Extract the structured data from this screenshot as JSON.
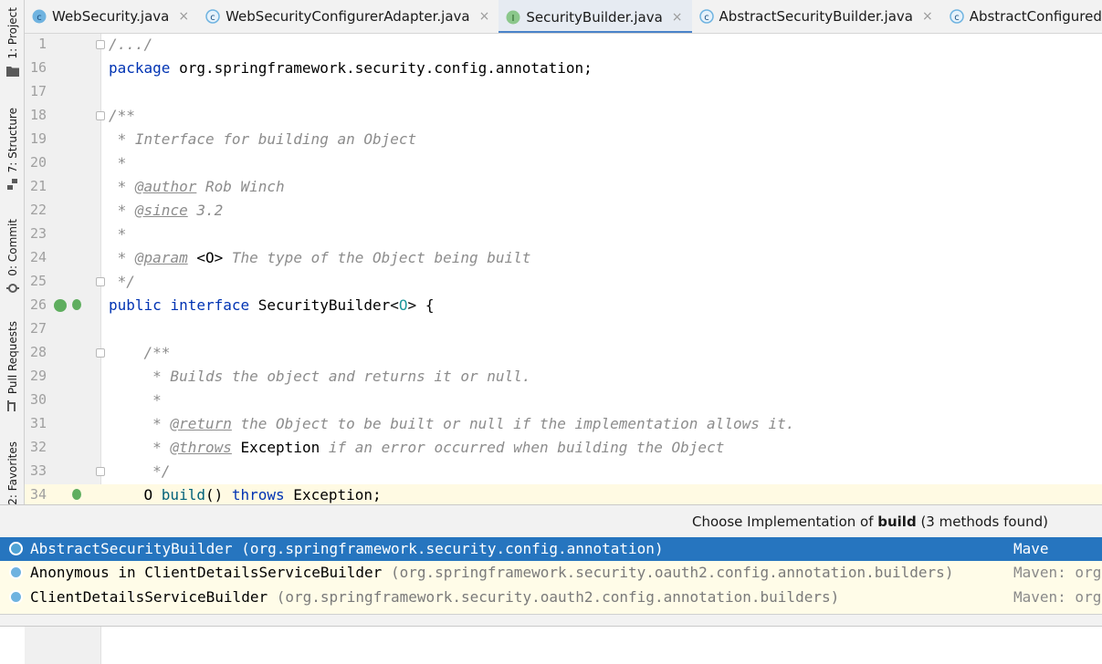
{
  "tool_windows": [
    {
      "label": "1: Project",
      "icon": "folder-icon"
    },
    {
      "label": "7: Structure",
      "icon": "structure-icon"
    },
    {
      "label": "0: Commit",
      "icon": "commit-icon"
    },
    {
      "label": "Pull Requests",
      "icon": "pull-request-icon"
    },
    {
      "label": "2: Favorites",
      "icon": "star-icon"
    }
  ],
  "tabs": [
    {
      "label": "WebSecurity.java",
      "icon": "class-icon",
      "close": "×"
    },
    {
      "label": "WebSecurityConfigurerAdapter.java",
      "icon": "abstract-class-icon",
      "close": "×"
    },
    {
      "label": "SecurityBuilder.java",
      "icon": "interface-icon",
      "close": "×",
      "active": true
    },
    {
      "label": "AbstractSecurityBuilder.java",
      "icon": "abstract-class-icon",
      "close": "×"
    },
    {
      "label": "AbstractConfiguredSe",
      "icon": "abstract-class-icon",
      "close": ""
    }
  ],
  "editor": {
    "lines": [
      {
        "n": "1",
        "text": "/.../"
      },
      {
        "n": "16",
        "text": "package org.springframework.security.config.annotation;"
      },
      {
        "n": "17",
        "text": ""
      },
      {
        "n": "18",
        "text": "/**"
      },
      {
        "n": "19",
        "text": " * Interface for building an Object"
      },
      {
        "n": "20",
        "text": " *"
      },
      {
        "n": "21",
        "text": " * @author Rob Winch"
      },
      {
        "n": "22",
        "text": " * @since 3.2"
      },
      {
        "n": "23",
        "text": " *"
      },
      {
        "n": "24",
        "text": " * @param <O> The type of the Object being built"
      },
      {
        "n": "25",
        "text": " */"
      },
      {
        "n": "26",
        "text": "public interface SecurityBuilder<O> {"
      },
      {
        "n": "27",
        "text": ""
      },
      {
        "n": "28",
        "text": "    /**"
      },
      {
        "n": "29",
        "text": "     * Builds the object and returns it or null."
      },
      {
        "n": "30",
        "text": "     *"
      },
      {
        "n": "31",
        "text": "     * @return the Object to be built or null if the implementation allows it."
      },
      {
        "n": "32",
        "text": "     * @throws Exception if an error occurred when building the Object"
      },
      {
        "n": "33",
        "text": "     */"
      },
      {
        "n": "34",
        "text": "    O build() throws Exception;"
      }
    ]
  },
  "popup": {
    "title_prefix": "Choose Implementation of ",
    "title_method": "build",
    "title_suffix": " (3 methods found)",
    "items": [
      {
        "name": "AbstractSecurityBuilder",
        "package": " (org.springframework.security.config.annotation)",
        "source": "Mave",
        "selected": true
      },
      {
        "name": "Anonymous in ClientDetailsServiceBuilder",
        "package": " (org.springframework.security.oauth2.config.annotation.builders)",
        "source": "Maven: org",
        "selected": false
      },
      {
        "name": "ClientDetailsServiceBuilder",
        "package": " (org.springframework.security.oauth2.config.annotation.builders)",
        "source": "Maven: org",
        "selected": false
      }
    ]
  },
  "colors": {
    "keyword": "#0033b3",
    "comment": "#8c8c8c",
    "selection": "#2675bf",
    "active_tab_underline": "#4a83c9",
    "popup_background": "#fffce8"
  }
}
